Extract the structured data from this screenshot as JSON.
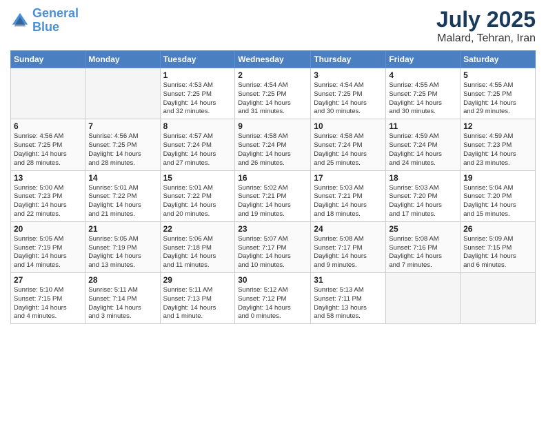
{
  "header": {
    "logo_line1": "General",
    "logo_line2": "Blue",
    "month": "July 2025",
    "location": "Malard, Tehran, Iran"
  },
  "weekdays": [
    "Sunday",
    "Monday",
    "Tuesday",
    "Wednesday",
    "Thursday",
    "Friday",
    "Saturday"
  ],
  "weeks": [
    [
      {
        "day": "",
        "detail": ""
      },
      {
        "day": "",
        "detail": ""
      },
      {
        "day": "1",
        "detail": "Sunrise: 4:53 AM\nSunset: 7:25 PM\nDaylight: 14 hours\nand 32 minutes."
      },
      {
        "day": "2",
        "detail": "Sunrise: 4:54 AM\nSunset: 7:25 PM\nDaylight: 14 hours\nand 31 minutes."
      },
      {
        "day": "3",
        "detail": "Sunrise: 4:54 AM\nSunset: 7:25 PM\nDaylight: 14 hours\nand 30 minutes."
      },
      {
        "day": "4",
        "detail": "Sunrise: 4:55 AM\nSunset: 7:25 PM\nDaylight: 14 hours\nand 30 minutes."
      },
      {
        "day": "5",
        "detail": "Sunrise: 4:55 AM\nSunset: 7:25 PM\nDaylight: 14 hours\nand 29 minutes."
      }
    ],
    [
      {
        "day": "6",
        "detail": "Sunrise: 4:56 AM\nSunset: 7:25 PM\nDaylight: 14 hours\nand 28 minutes."
      },
      {
        "day": "7",
        "detail": "Sunrise: 4:56 AM\nSunset: 7:25 PM\nDaylight: 14 hours\nand 28 minutes."
      },
      {
        "day": "8",
        "detail": "Sunrise: 4:57 AM\nSunset: 7:24 PM\nDaylight: 14 hours\nand 27 minutes."
      },
      {
        "day": "9",
        "detail": "Sunrise: 4:58 AM\nSunset: 7:24 PM\nDaylight: 14 hours\nand 26 minutes."
      },
      {
        "day": "10",
        "detail": "Sunrise: 4:58 AM\nSunset: 7:24 PM\nDaylight: 14 hours\nand 25 minutes."
      },
      {
        "day": "11",
        "detail": "Sunrise: 4:59 AM\nSunset: 7:24 PM\nDaylight: 14 hours\nand 24 minutes."
      },
      {
        "day": "12",
        "detail": "Sunrise: 4:59 AM\nSunset: 7:23 PM\nDaylight: 14 hours\nand 23 minutes."
      }
    ],
    [
      {
        "day": "13",
        "detail": "Sunrise: 5:00 AM\nSunset: 7:23 PM\nDaylight: 14 hours\nand 22 minutes."
      },
      {
        "day": "14",
        "detail": "Sunrise: 5:01 AM\nSunset: 7:22 PM\nDaylight: 14 hours\nand 21 minutes."
      },
      {
        "day": "15",
        "detail": "Sunrise: 5:01 AM\nSunset: 7:22 PM\nDaylight: 14 hours\nand 20 minutes."
      },
      {
        "day": "16",
        "detail": "Sunrise: 5:02 AM\nSunset: 7:21 PM\nDaylight: 14 hours\nand 19 minutes."
      },
      {
        "day": "17",
        "detail": "Sunrise: 5:03 AM\nSunset: 7:21 PM\nDaylight: 14 hours\nand 18 minutes."
      },
      {
        "day": "18",
        "detail": "Sunrise: 5:03 AM\nSunset: 7:20 PM\nDaylight: 14 hours\nand 17 minutes."
      },
      {
        "day": "19",
        "detail": "Sunrise: 5:04 AM\nSunset: 7:20 PM\nDaylight: 14 hours\nand 15 minutes."
      }
    ],
    [
      {
        "day": "20",
        "detail": "Sunrise: 5:05 AM\nSunset: 7:19 PM\nDaylight: 14 hours\nand 14 minutes."
      },
      {
        "day": "21",
        "detail": "Sunrise: 5:05 AM\nSunset: 7:19 PM\nDaylight: 14 hours\nand 13 minutes."
      },
      {
        "day": "22",
        "detail": "Sunrise: 5:06 AM\nSunset: 7:18 PM\nDaylight: 14 hours\nand 11 minutes."
      },
      {
        "day": "23",
        "detail": "Sunrise: 5:07 AM\nSunset: 7:17 PM\nDaylight: 14 hours\nand 10 minutes."
      },
      {
        "day": "24",
        "detail": "Sunrise: 5:08 AM\nSunset: 7:17 PM\nDaylight: 14 hours\nand 9 minutes."
      },
      {
        "day": "25",
        "detail": "Sunrise: 5:08 AM\nSunset: 7:16 PM\nDaylight: 14 hours\nand 7 minutes."
      },
      {
        "day": "26",
        "detail": "Sunrise: 5:09 AM\nSunset: 7:15 PM\nDaylight: 14 hours\nand 6 minutes."
      }
    ],
    [
      {
        "day": "27",
        "detail": "Sunrise: 5:10 AM\nSunset: 7:15 PM\nDaylight: 14 hours\nand 4 minutes."
      },
      {
        "day": "28",
        "detail": "Sunrise: 5:11 AM\nSunset: 7:14 PM\nDaylight: 14 hours\nand 3 minutes."
      },
      {
        "day": "29",
        "detail": "Sunrise: 5:11 AM\nSunset: 7:13 PM\nDaylight: 14 hours\nand 1 minute."
      },
      {
        "day": "30",
        "detail": "Sunrise: 5:12 AM\nSunset: 7:12 PM\nDaylight: 14 hours\nand 0 minutes."
      },
      {
        "day": "31",
        "detail": "Sunrise: 5:13 AM\nSunset: 7:11 PM\nDaylight: 13 hours\nand 58 minutes."
      },
      {
        "day": "",
        "detail": ""
      },
      {
        "day": "",
        "detail": ""
      }
    ]
  ]
}
